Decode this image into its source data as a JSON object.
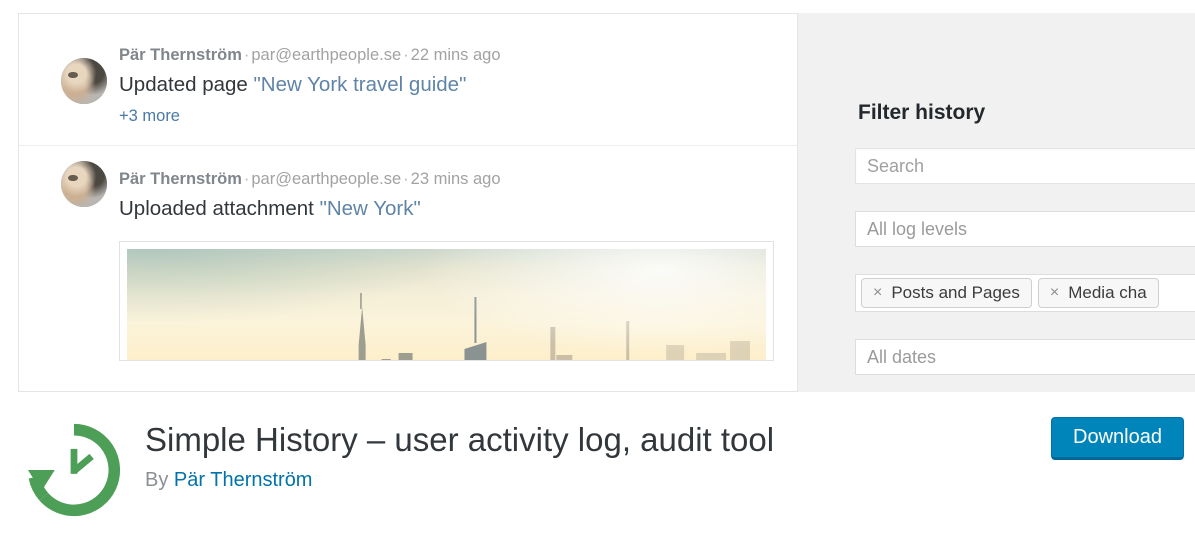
{
  "screenshot": {
    "feed": {
      "entries": [
        {
          "author": "Pär Thernström",
          "email": "par@earthpeople.se",
          "time": "22 mins ago",
          "separator": "·",
          "action_prefix": "Updated page ",
          "action_target": "\"New York travel guide\"",
          "more_label": "+3 more"
        },
        {
          "author": "Pär Thernström",
          "email": "par@earthpeople.se",
          "time": "23 mins ago",
          "separator": "·",
          "action_prefix": "Uploaded attachment ",
          "action_target": "\"New York\"",
          "attachment_alt": "New York City skyline at dusk"
        }
      ]
    },
    "filter": {
      "title": "Filter history",
      "search_placeholder": "Search",
      "log_levels_value": "All log levels",
      "tags": [
        {
          "remove": "×",
          "label": "Posts and Pages"
        },
        {
          "remove": "×",
          "label": "Media cha"
        }
      ],
      "dates_value": "All dates"
    }
  },
  "footer": {
    "icon_name": "history-clock-icon",
    "plugin_title": "Simple History – user activity log, audit tool",
    "by_label": "By",
    "author": "Pär Thernström",
    "download_label": "Download"
  },
  "colors": {
    "accent_blue": "#0085ba",
    "link_blue": "#0073aa",
    "icon_green": "#4d9e56",
    "panel_gray": "#f1f1f1",
    "title_dark": "#32373c"
  }
}
